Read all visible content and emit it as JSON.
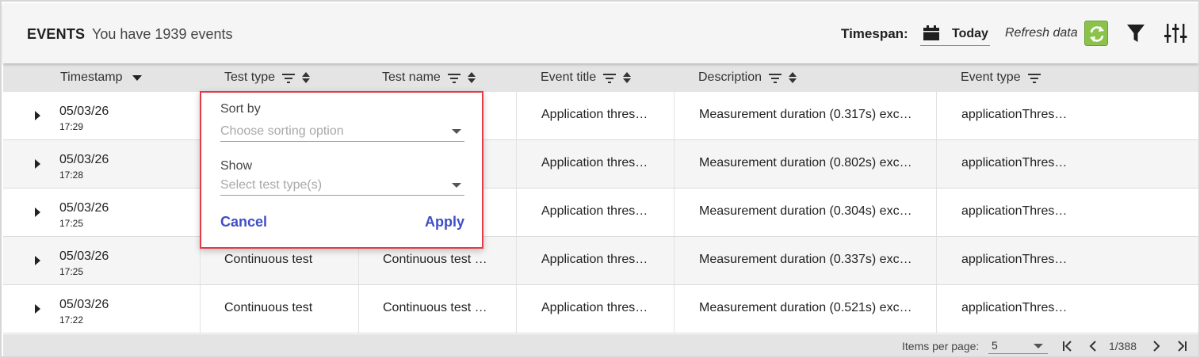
{
  "header": {
    "title": "EVENTS",
    "subtitle": "You have 1939 events",
    "timespan_label": "Timespan:",
    "timespan_value": "Today",
    "refresh_label": "Refresh data",
    "refresh_color": "#8bc34a"
  },
  "columns": [
    {
      "label": "Timestamp",
      "icons": [
        "sort-desc-arrow-icon"
      ]
    },
    {
      "label": "Test type",
      "icons": [
        "filter-lines-icon",
        "sort-updown-icon"
      ]
    },
    {
      "label": "Test name",
      "icons": [
        "filter-lines-icon",
        "sort-updown-icon"
      ]
    },
    {
      "label": "Event title",
      "icons": [
        "filter-lines-icon",
        "sort-updown-icon"
      ]
    },
    {
      "label": "Description",
      "icons": [
        "filter-lines-icon",
        "sort-updown-icon"
      ]
    },
    {
      "label": "Event type",
      "icons": [
        "filter-lines-icon"
      ]
    }
  ],
  "rows": [
    {
      "date": "05/03/26",
      "time": "17:29",
      "test_type": "",
      "test_name": "",
      "event_title": "Application thres…",
      "description": "Measurement duration (0.317s) exc…",
      "event_type": "applicationThres…"
    },
    {
      "date": "05/03/26",
      "time": "17:28",
      "test_type": "",
      "test_name": "",
      "event_title": "Application thres…",
      "description": "Measurement duration (0.802s) exc…",
      "event_type": "applicationThres…"
    },
    {
      "date": "05/03/26",
      "time": "17:25",
      "test_type": "",
      "test_name": "",
      "event_title": "Application thres…",
      "description": "Measurement duration (0.304s) exc…",
      "event_type": "applicationThres…"
    },
    {
      "date": "05/03/26",
      "time": "17:25",
      "test_type": "Continuous test",
      "test_name": "Continuous test …",
      "event_title": "Application thres…",
      "description": "Measurement duration (0.337s) exc…",
      "event_type": "applicationThres…"
    },
    {
      "date": "05/03/26",
      "time": "17:22",
      "test_type": "Continuous test",
      "test_name": "Continuous test …",
      "event_title": "Application thres…",
      "description": "Measurement duration (0.521s) exc…",
      "event_type": "applicationThres…"
    }
  ],
  "footer": {
    "items_per_page_label": "Items per page:",
    "items_per_page_value": "5",
    "page_indicator": "1/388"
  },
  "popup": {
    "sort_label": "Sort by",
    "sort_placeholder": "Choose sorting option",
    "show_label": "Show",
    "show_placeholder": "Select test type(s)",
    "cancel_label": "Cancel",
    "apply_label": "Apply",
    "border_color": "#e53945",
    "action_color": "#3f4ec7"
  }
}
